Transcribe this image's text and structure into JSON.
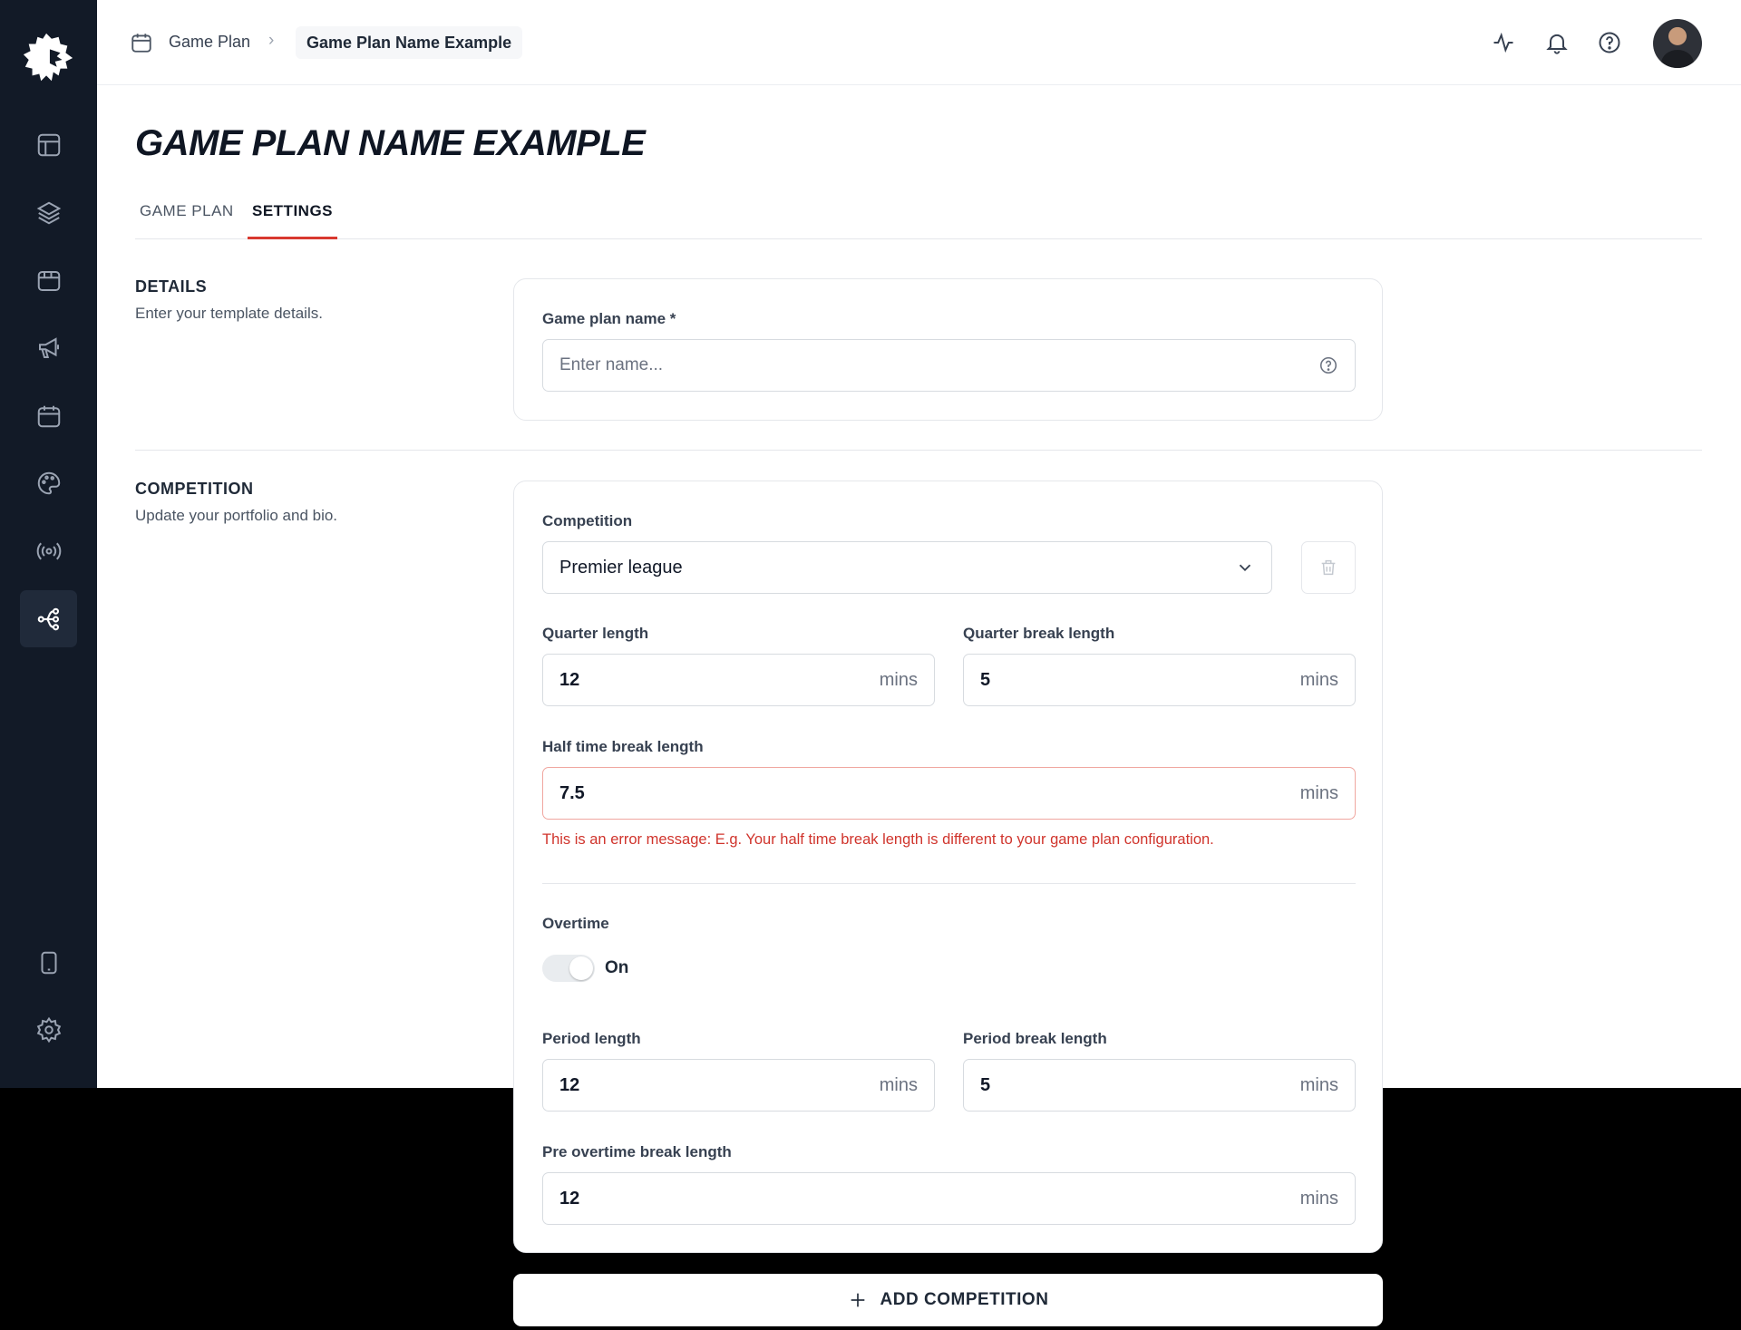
{
  "breadcrumb": {
    "parent": "Game Plan",
    "separator": "›",
    "current": "Game Plan Name Example"
  },
  "page": {
    "title": "GAME PLAN NAME EXAMPLE"
  },
  "tabs": [
    {
      "label": "GAME PLAN"
    },
    {
      "label": "SETTINGS"
    }
  ],
  "details": {
    "title": "DETAILS",
    "subtitle": "Enter your template details.",
    "name_label": "Game plan name *",
    "name_placeholder": "Enter name..."
  },
  "competition": {
    "title": "COMPETITION",
    "subtitle": "Update your portfolio and bio.",
    "competition_label": "Competition",
    "competition_value": "Premier league",
    "quarter_length_label": "Quarter length",
    "quarter_length_value": "12",
    "quarter_break_label": "Quarter break length",
    "quarter_break_value": "5",
    "half_time_label": "Half time break length",
    "half_time_value": "7.5",
    "error_message": "This is an error message: E.g. Your half time break length is different to your game plan configuration.",
    "overtime_label": "Overtime",
    "overtime_state": "On",
    "period_length_label": "Period length",
    "period_length_value": "12",
    "period_break_label": "Period break length",
    "period_break_value": "5",
    "pre_overtime_label": "Pre overtime break length",
    "pre_overtime_value": "12",
    "unit": "mins"
  },
  "add_competition": {
    "label": "ADD COMPETITION"
  },
  "icons": {
    "sidebar": [
      "layout-icon",
      "layers-icon",
      "browser-icon",
      "megaphone-icon",
      "calendar-icon",
      "palette-icon",
      "broadcast-icon",
      "flow-icon",
      "tablet-icon",
      "gear-icon"
    ],
    "top": [
      "activity-icon",
      "bell-icon",
      "help-icon"
    ]
  },
  "colors": {
    "sidebar": "#121a27",
    "accent": "#d9392f",
    "error": "#d0342c"
  }
}
